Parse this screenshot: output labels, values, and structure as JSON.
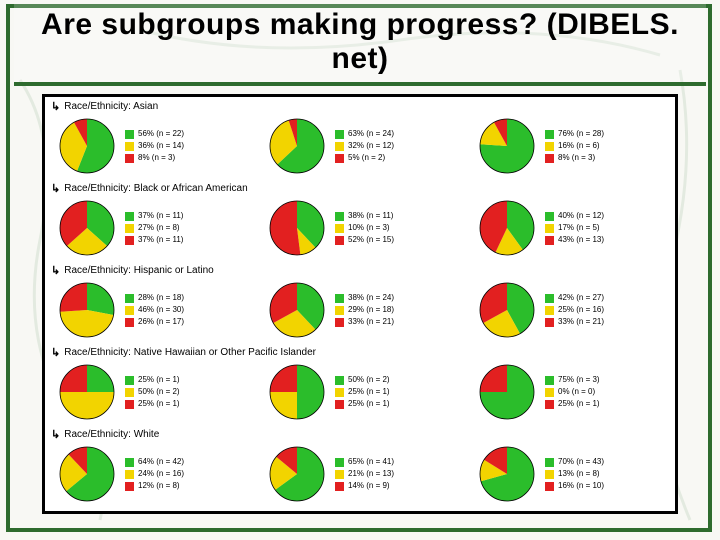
{
  "title": "Are subgroups making progress? (DIBELS. net)",
  "colors": {
    "green": "#2bbd2b",
    "yellow": "#f2d400",
    "red": "#e22020"
  },
  "chart_data": [
    {
      "group": "Race/Ethnicity: Asian",
      "columns": [
        {
          "type": "pie",
          "series": [
            {
              "name": "green",
              "pct": 56,
              "n": 22
            },
            {
              "name": "yellow",
              "pct": 36,
              "n": 14
            },
            {
              "name": "red",
              "pct": 8,
              "n": 3
            }
          ]
        },
        {
          "type": "pie",
          "series": [
            {
              "name": "green",
              "pct": 63,
              "n": 24
            },
            {
              "name": "yellow",
              "pct": 32,
              "n": 12
            },
            {
              "name": "red",
              "pct": 5,
              "n": 2
            }
          ]
        },
        {
          "type": "pie",
          "series": [
            {
              "name": "green",
              "pct": 76,
              "n": 28
            },
            {
              "name": "yellow",
              "pct": 16,
              "n": 6
            },
            {
              "name": "red",
              "pct": 8,
              "n": 3
            }
          ]
        }
      ]
    },
    {
      "group": "Race/Ethnicity: Black or African American",
      "columns": [
        {
          "type": "pie",
          "series": [
            {
              "name": "green",
              "pct": 37,
              "n": 11
            },
            {
              "name": "yellow",
              "pct": 27,
              "n": 8
            },
            {
              "name": "red",
              "pct": 37,
              "n": 11
            }
          ]
        },
        {
          "type": "pie",
          "series": [
            {
              "name": "green",
              "pct": 38,
              "n": 11
            },
            {
              "name": "yellow",
              "pct": 10,
              "n": 3
            },
            {
              "name": "red",
              "pct": 52,
              "n": 15
            }
          ]
        },
        {
          "type": "pie",
          "series": [
            {
              "name": "green",
              "pct": 40,
              "n": 12
            },
            {
              "name": "yellow",
              "pct": 17,
              "n": 5
            },
            {
              "name": "red",
              "pct": 43,
              "n": 13
            }
          ]
        }
      ]
    },
    {
      "group": "Race/Ethnicity: Hispanic or Latino",
      "columns": [
        {
          "type": "pie",
          "series": [
            {
              "name": "green",
              "pct": 28,
              "n": 18
            },
            {
              "name": "yellow",
              "pct": 46,
              "n": 30
            },
            {
              "name": "red",
              "pct": 26,
              "n": 17
            }
          ]
        },
        {
          "type": "pie",
          "series": [
            {
              "name": "green",
              "pct": 38,
              "n": 24
            },
            {
              "name": "yellow",
              "pct": 29,
              "n": 18
            },
            {
              "name": "red",
              "pct": 33,
              "n": 21
            }
          ]
        },
        {
          "type": "pie",
          "series": [
            {
              "name": "green",
              "pct": 42,
              "n": 27
            },
            {
              "name": "yellow",
              "pct": 25,
              "n": 16
            },
            {
              "name": "red",
              "pct": 33,
              "n": 21
            }
          ]
        }
      ]
    },
    {
      "group": "Race/Ethnicity: Native Hawaiian or Other Pacific Islander",
      "columns": [
        {
          "type": "pie",
          "series": [
            {
              "name": "green",
              "pct": 25,
              "n": 1
            },
            {
              "name": "yellow",
              "pct": 50,
              "n": 2
            },
            {
              "name": "red",
              "pct": 25,
              "n": 1
            }
          ]
        },
        {
          "type": "pie",
          "series": [
            {
              "name": "green",
              "pct": 50,
              "n": 2
            },
            {
              "name": "yellow",
              "pct": 25,
              "n": 1
            },
            {
              "name": "red",
              "pct": 25,
              "n": 1
            }
          ]
        },
        {
          "type": "pie",
          "series": [
            {
              "name": "green",
              "pct": 75,
              "n": 3
            },
            {
              "name": "yellow",
              "pct": 0,
              "n": 0
            },
            {
              "name": "red",
              "pct": 25,
              "n": 1
            }
          ]
        }
      ]
    },
    {
      "group": "Race/Ethnicity: White",
      "columns": [
        {
          "type": "pie",
          "series": [
            {
              "name": "green",
              "pct": 64,
              "n": 42
            },
            {
              "name": "yellow",
              "pct": 24,
              "n": 16
            },
            {
              "name": "red",
              "pct": 12,
              "n": 8
            }
          ]
        },
        {
          "type": "pie",
          "series": [
            {
              "name": "green",
              "pct": 65,
              "n": 41
            },
            {
              "name": "yellow",
              "pct": 21,
              "n": 13
            },
            {
              "name": "red",
              "pct": 14,
              "n": 9
            }
          ]
        },
        {
          "type": "pie",
          "series": [
            {
              "name": "green",
              "pct": 70,
              "n": 43
            },
            {
              "name": "yellow",
              "pct": 13,
              "n": 8
            },
            {
              "name": "red",
              "pct": 16,
              "n": 10
            }
          ]
        }
      ]
    }
  ]
}
